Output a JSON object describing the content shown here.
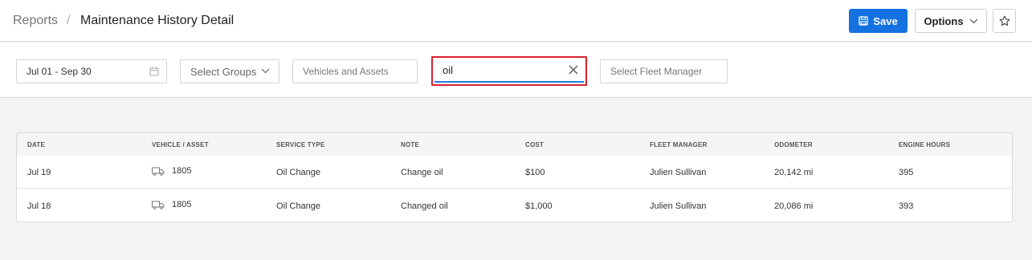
{
  "header": {
    "breadcrumb_root": "Reports",
    "breadcrumb_separator": "/",
    "title": "Maintenance History Detail",
    "save_label": "Save",
    "options_label": "Options"
  },
  "filters": {
    "date_range": "Jul 01 - Sep 30",
    "groups_placeholder": "Select Groups",
    "vehicles_placeholder": "Vehicles and Assets",
    "search_value": "oil",
    "fleet_manager_placeholder": "Select Fleet Manager"
  },
  "table": {
    "columns": [
      "DATE",
      "VEHICLE / ASSET",
      "SERVICE TYPE",
      "NOTE",
      "COST",
      "FLEET MANAGER",
      "ODOMETER",
      "ENGINE HOURS"
    ],
    "rows": [
      {
        "date": "Jul 19",
        "vehicle": "1805",
        "service_type": "Oil Change",
        "note": "Change oil",
        "cost": "$100",
        "fleet_manager": "Julien Sullivan",
        "odometer": "20,142 mi",
        "engine_hours": "395"
      },
      {
        "date": "Jul 18",
        "vehicle": "1805",
        "service_type": "Oil Change",
        "note": "Changed oil",
        "cost": "$1,000",
        "fleet_manager": "Julien Sullivan",
        "odometer": "20,086 mi",
        "engine_hours": "393"
      }
    ]
  },
  "colors": {
    "accent": "#1372e0",
    "highlight_border": "#d9232d",
    "focus_underline": "#2a7ae4"
  },
  "icons": {
    "save": "floppy-disk-icon",
    "options": "chevron-down-icon",
    "favorite": "star-icon",
    "date": "calendar-icon",
    "groups": "chevron-down-icon",
    "clear": "close-icon",
    "vehicle": "truck-icon"
  }
}
